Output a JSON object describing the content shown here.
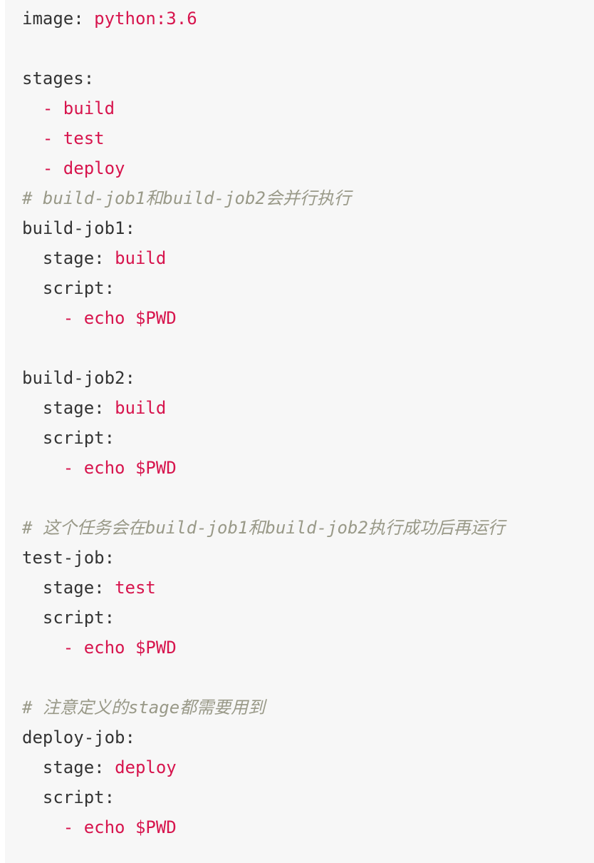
{
  "code_block": {
    "language": "yaml",
    "colors": {
      "background": "#f7f7f7",
      "text": "#333333",
      "value": "#d7144d",
      "comment": "#999988"
    },
    "lines": [
      {
        "indent": "",
        "key": "image",
        "sep": ": ",
        "value": "python:3.6"
      },
      {
        "blank": true
      },
      {
        "indent": "",
        "key": "stages",
        "sep": ":"
      },
      {
        "indent": "  ",
        "value": "- build"
      },
      {
        "indent": "  ",
        "value": "- test"
      },
      {
        "indent": "  ",
        "value": "- deploy"
      },
      {
        "indent": "",
        "comment": "# build-job1和build-job2会并行执行"
      },
      {
        "indent": "",
        "key": "build-job1",
        "sep": ":"
      },
      {
        "indent": "  ",
        "key": "stage",
        "sep": ": ",
        "value": "build"
      },
      {
        "indent": "  ",
        "key": "script",
        "sep": ":"
      },
      {
        "indent": "    ",
        "value": "- echo $PWD"
      },
      {
        "blank": true
      },
      {
        "indent": "",
        "key": "build-job2",
        "sep": ":"
      },
      {
        "indent": "  ",
        "key": "stage",
        "sep": ": ",
        "value": "build"
      },
      {
        "indent": "  ",
        "key": "script",
        "sep": ":"
      },
      {
        "indent": "    ",
        "value": "- echo $PWD"
      },
      {
        "blank": true
      },
      {
        "indent": "",
        "comment": "# 这个任务会在build-job1和build-job2执行成功后再运行"
      },
      {
        "indent": "",
        "key": "test-job",
        "sep": ":"
      },
      {
        "indent": "  ",
        "key": "stage",
        "sep": ": ",
        "value": "test"
      },
      {
        "indent": "  ",
        "key": "script",
        "sep": ":"
      },
      {
        "indent": "    ",
        "value": "- echo $PWD"
      },
      {
        "blank": true
      },
      {
        "indent": "",
        "comment": "# 注意定义的stage都需要用到"
      },
      {
        "indent": "",
        "key": "deploy-job",
        "sep": ":"
      },
      {
        "indent": "  ",
        "key": "stage",
        "sep": ": ",
        "value": "deploy"
      },
      {
        "indent": "  ",
        "key": "script",
        "sep": ":"
      },
      {
        "indent": "    ",
        "value": "- echo $PWD"
      }
    ]
  }
}
